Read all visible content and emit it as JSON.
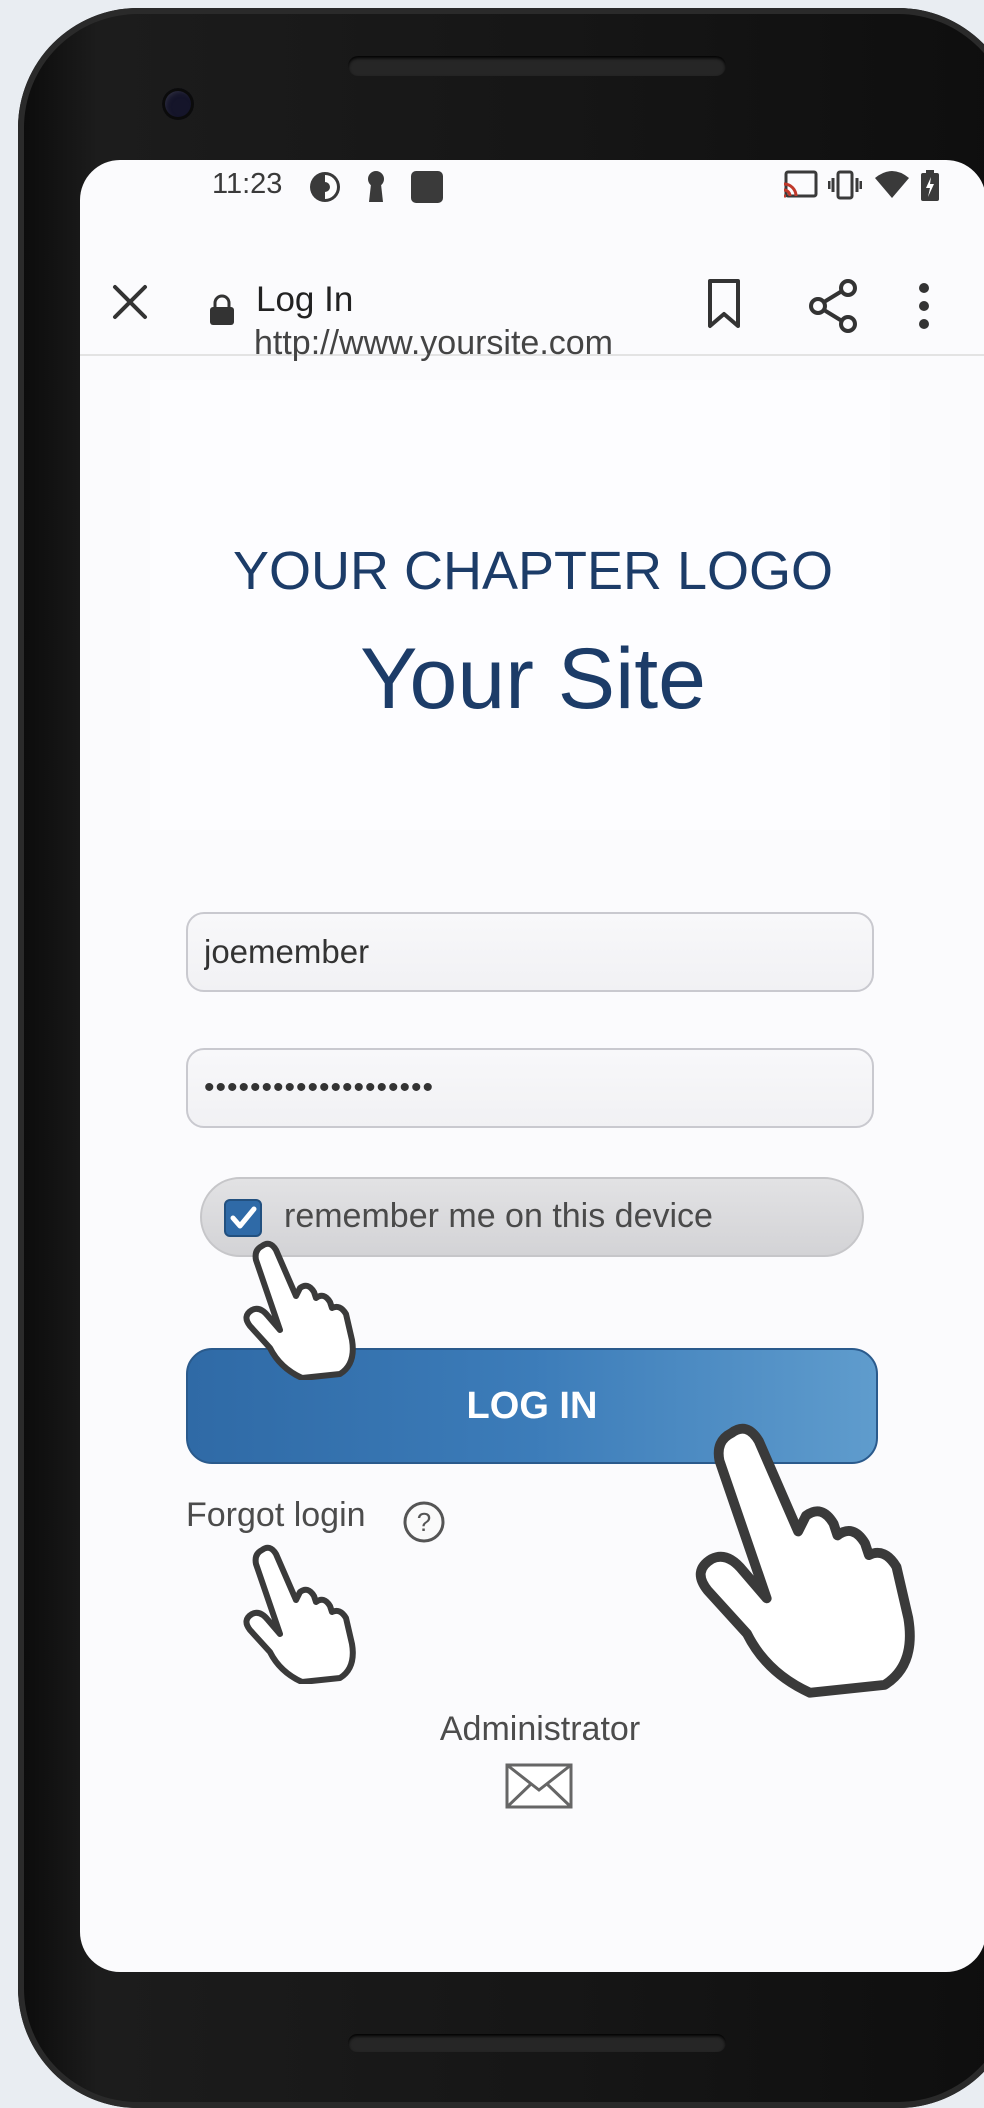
{
  "status_bar": {
    "time": "11:23",
    "left_icons": [
      "data-saver-icon",
      "keyhole-icon",
      "square-notification-icon"
    ],
    "right_icons": [
      "cast-icon",
      "vibrate-icon",
      "wifi-icon",
      "battery-charging-icon"
    ]
  },
  "browser": {
    "page_title": "Log In",
    "url": "http://www.yoursite.com",
    "icons": [
      "close-icon",
      "lock-icon",
      "bookmark-icon",
      "share-icon",
      "more-vert-icon"
    ]
  },
  "header": {
    "chapter_logo": "YOUR CHAPTER LOGO",
    "site_title": "Your Site"
  },
  "form": {
    "username_value": "joemember",
    "password_value": "••••••••••••••••••••",
    "remember_label": "remember me on this device",
    "remember_checked": true,
    "login_label": "LOG IN",
    "forgot_label": "Forgot login",
    "help_symbol": "?"
  },
  "footer": {
    "admin_label": "Administrator",
    "icon": "mail-icon"
  },
  "colors": {
    "brand_navy": "#1c3c68",
    "button_blue": "#3c7cb9",
    "checkbox_blue": "#2f6aa7"
  }
}
